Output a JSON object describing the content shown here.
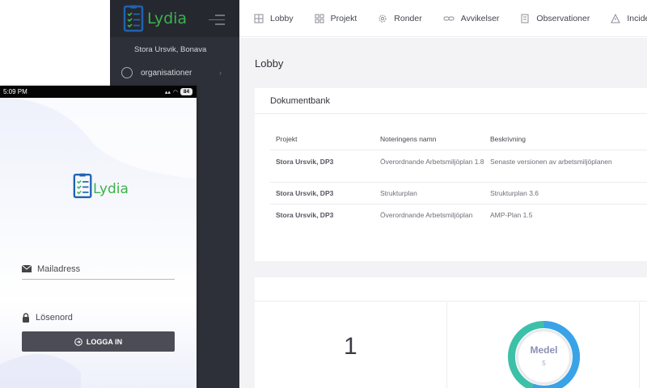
{
  "app": {
    "logo_text": "Lydia",
    "brand_color": "#3cb34a",
    "accent_blue": "#1e63b0"
  },
  "sidebar": {
    "user_name": "Stora Ursvik, Bonava",
    "items": [
      {
        "label": "organisationer",
        "icon": "globe-icon"
      }
    ]
  },
  "topnav": {
    "items": [
      {
        "label": "Lobby",
        "icon": "grid-icon"
      },
      {
        "label": "Projekt",
        "icon": "squares-icon"
      },
      {
        "label": "Ronder",
        "icon": "gear-icon"
      },
      {
        "label": "Avvikelser",
        "icon": "link-icon"
      },
      {
        "label": "Observationer",
        "icon": "document-icon"
      },
      {
        "label": "Incider",
        "icon": "warning-icon"
      }
    ]
  },
  "main": {
    "page_title": "Lobby",
    "documents": {
      "title": "Dokumentbank",
      "columns": [
        "Projekt",
        "Noteringens namn",
        "Beskrivning"
      ],
      "rows": [
        {
          "project": "Stora Ursvik, DP3",
          "name": "Överordnande Arbetsmiljöplan 1.8",
          "description": "Senaste versionen av arbetsmiljöplanen"
        },
        {
          "project": "Stora Ursvik, DP3",
          "name": "Strukturplan",
          "description": "Strukturplan 3.6"
        },
        {
          "project": "Stora Ursvik, DP3",
          "name": "Överordnande Arbetsmiljöplan",
          "description": "AMP-Plan 1.5"
        }
      ]
    },
    "stats": {
      "count": "1",
      "gauge_label": "Medel",
      "gauge_value": "5",
      "gauge_colors": [
        "#3aa3e8",
        "#3cc1a8"
      ]
    }
  },
  "phone": {
    "status_time": "5:09 PM",
    "battery": "84",
    "logo_text": "Lydia",
    "email_placeholder": "Mailadress",
    "password_placeholder": "Lösenord",
    "login_label": "LOGGA IN"
  }
}
